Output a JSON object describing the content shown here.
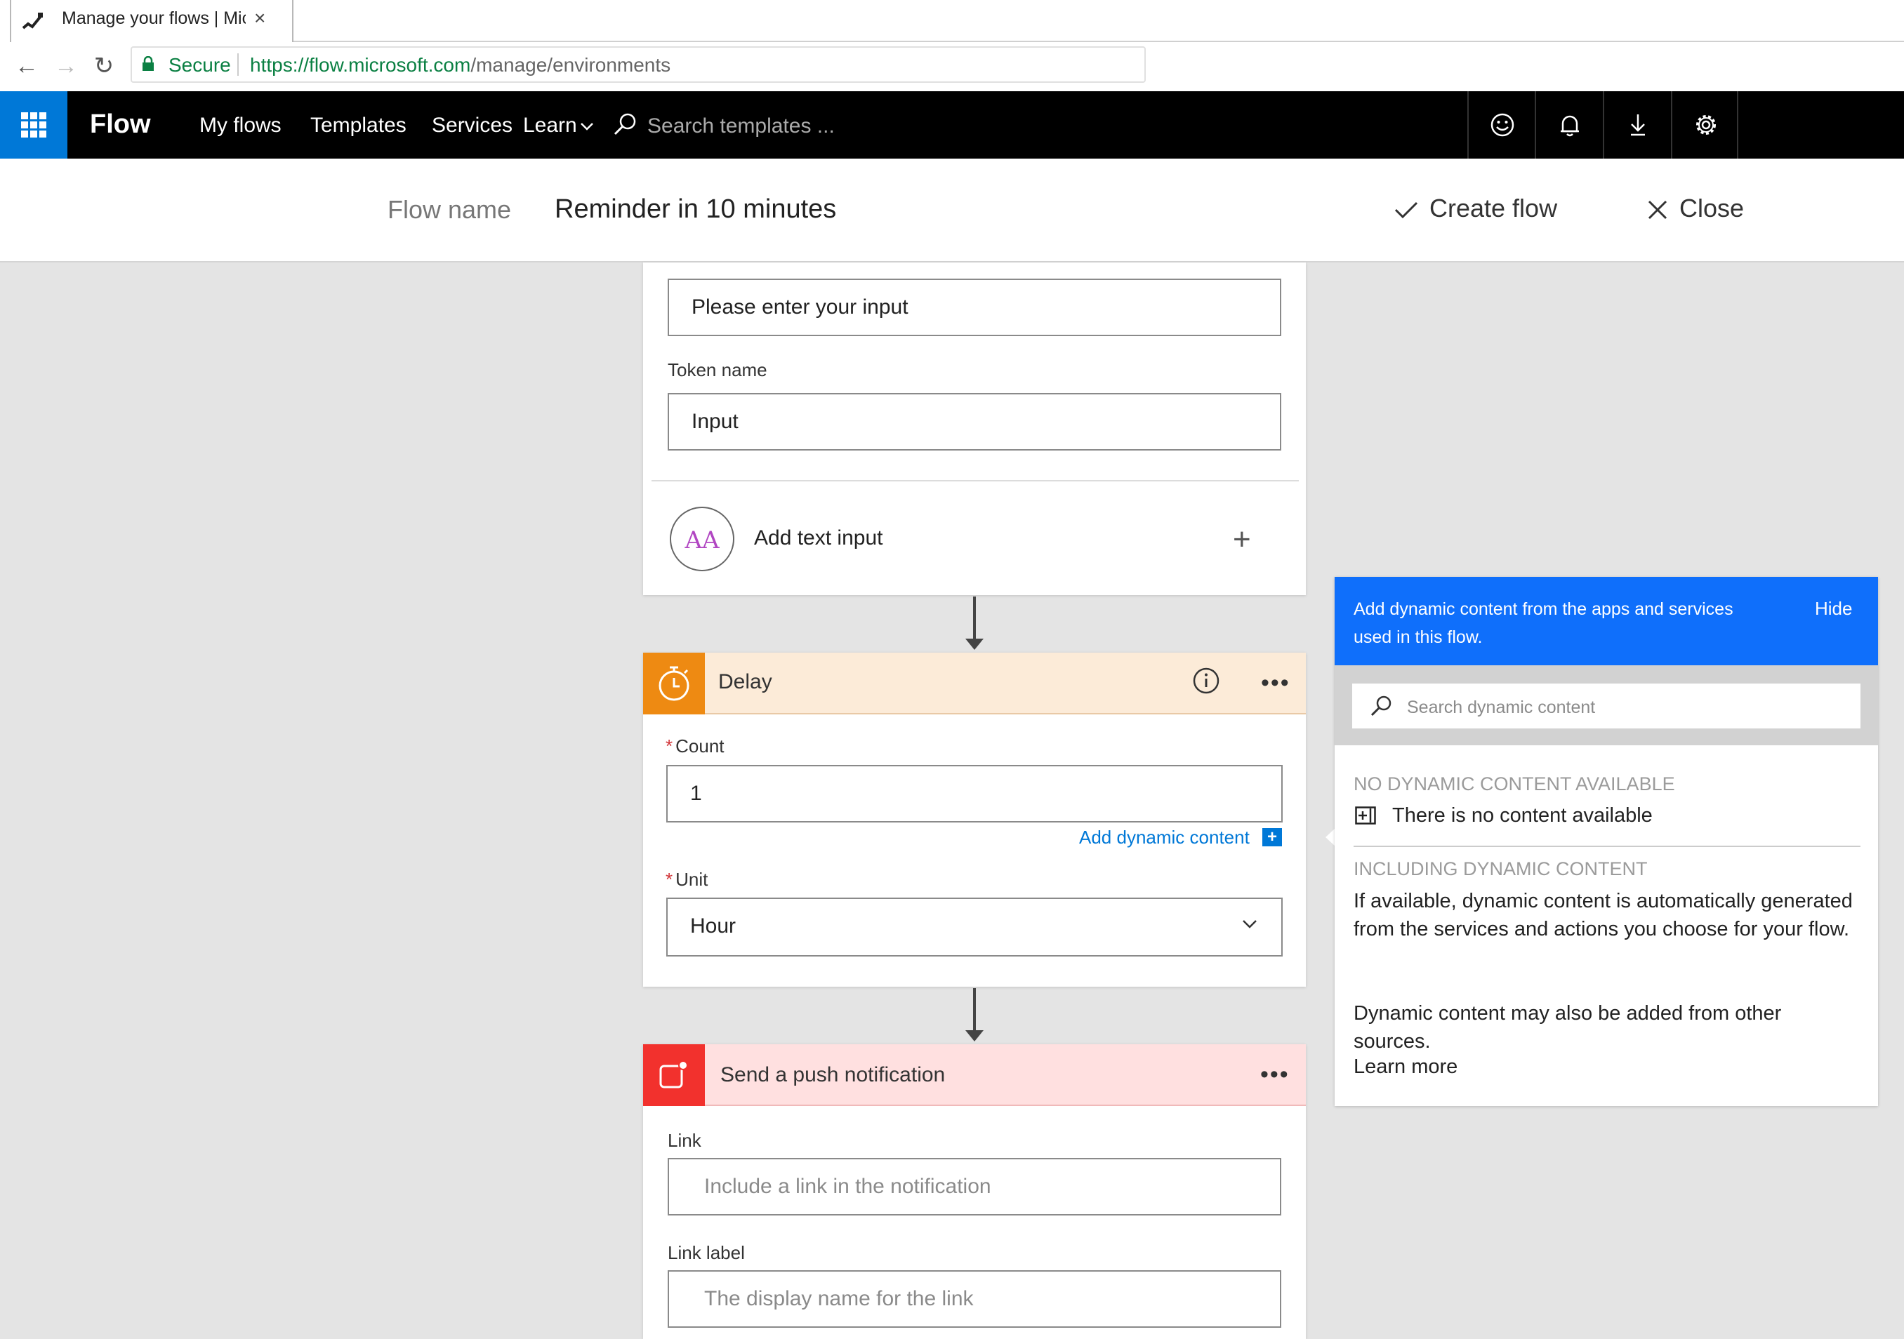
{
  "browser": {
    "tab_title": "Manage your flows | Microsoft Flow",
    "tab_close": "×",
    "secure_label": "Secure",
    "url_host": "https://flow.microsoft.com",
    "url_path": "/manage/environments"
  },
  "nav": {
    "brand": "Flow",
    "links": [
      "My flows",
      "Templates",
      "Services",
      "Learn"
    ],
    "search_placeholder": "Search templates ...",
    "icons": [
      "smiley-icon",
      "bell-icon",
      "download-icon",
      "gear-icon"
    ]
  },
  "header": {
    "flow_name_label": "Flow name",
    "flow_name_value": "Reminder in 10 minutes",
    "create_flow": "Create flow",
    "close": "Close"
  },
  "trigger_card": {
    "prompt_value": "Please enter your input",
    "token_label": "Token name",
    "token_value": "Input",
    "add_text_input_icon": "AA",
    "add_text_input_label": "Add text input",
    "plus": "+"
  },
  "delay_card": {
    "title": "Delay",
    "menu": "•••",
    "required_mark": "*",
    "count_label": "Count",
    "count_value": "1",
    "add_dynamic_content": "Add dynamic content",
    "add_dynamic_plus": "+",
    "unit_label": "Unit",
    "unit_value": "Hour"
  },
  "push_card": {
    "title": "Send a push notification",
    "menu": "•••",
    "link_label": "Link",
    "link_placeholder": "Include a link in the notification",
    "link_label_label": "Link label",
    "link_label_placeholder": "The display name for the link"
  },
  "dynamic_panel": {
    "header_text": "Add dynamic content from the apps and services used in this flow.",
    "hide": "Hide",
    "search_placeholder": "Search dynamic content",
    "no_content_title": "NO DYNAMIC CONTENT AVAILABLE",
    "no_content_text": "There is no content available",
    "including_title": "INCLUDING DYNAMIC CONTENT",
    "including_text": "If available, dynamic content is automatically generated from the services and actions you choose for your flow.",
    "including_text2": "Dynamic content may also be added from other sources.",
    "learn_more": "Learn more"
  },
  "colors": {
    "brand_blue": "#0078d7",
    "delay_orange": "#ee8a12",
    "push_red": "#f2312d",
    "panel_blue": "#0f6ffb"
  }
}
